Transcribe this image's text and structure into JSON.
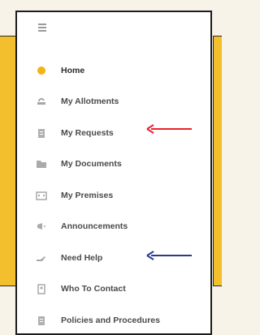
{
  "menu": {
    "items": [
      {
        "label": "Home",
        "icon": "sun-icon"
      },
      {
        "label": "My Allotments",
        "icon": "seedling-icon"
      },
      {
        "label": "My Requests",
        "icon": "document-icon"
      },
      {
        "label": "My Documents",
        "icon": "folder-icon"
      },
      {
        "label": "My Premises",
        "icon": "building-icon"
      },
      {
        "label": "Announcements",
        "icon": "megaphone-icon"
      },
      {
        "label": "Need Help",
        "icon": "help-hand-icon"
      },
      {
        "label": "Who To Contact",
        "icon": "contact-book-icon"
      },
      {
        "label": "Policies and Procedures",
        "icon": "policy-doc-icon"
      }
    ]
  },
  "annotations": {
    "red_arrow_color": "#e8232b",
    "blue_arrow_color": "#2a3a8f"
  },
  "colors": {
    "accent": "#f3bf2c",
    "home_icon": "#f2b315"
  }
}
